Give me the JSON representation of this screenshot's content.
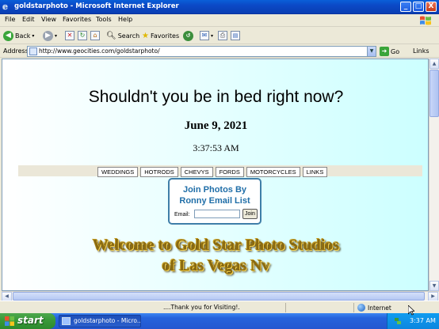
{
  "window": {
    "title": "goldstarphoto - Microsoft Internet Explorer",
    "min_glyph": "_",
    "max_glyph": "□",
    "close_glyph": "X"
  },
  "menu": [
    "File",
    "Edit",
    "View",
    "Favorites",
    "Tools",
    "Help"
  ],
  "toolbar": {
    "back_label": "Back",
    "search_label": "Search",
    "favorites_label": "Favorites"
  },
  "address": {
    "label": "Address",
    "url": "http://www.geocities.com/goldstarphoto/",
    "go_label": "Go",
    "links_label": "Links"
  },
  "page": {
    "heading": "Shouldn't you be in bed right now?",
    "date": "June 9, 2021",
    "time": "3:37:53 AM",
    "nav": [
      "WEDDINGS",
      "HOTRODS",
      "CHEVYS",
      "FORDS",
      "MOTORCYCLES",
      "LINKS"
    ],
    "join_title_line1": "Join Photos By",
    "join_title_line2": "Ronny Email List",
    "email_label": "Email:",
    "join_button": "Join",
    "welcome_line1": "Welcome to Gold Star Photo Studios",
    "welcome_line2": "of Las Vegas Nv"
  },
  "status": {
    "message": "....Thank you for Visiting!.",
    "zone": "Internet"
  },
  "taskbar": {
    "start_label": "start",
    "task_label": "goldstarphoto - Micro...",
    "clock": "3:37 AM"
  },
  "colors": {
    "titlebar": "#0b49c6",
    "content_gradient_end": "#ccffff",
    "join_title": "#1f6ea8",
    "welcome_gold": "#8a6a10"
  }
}
